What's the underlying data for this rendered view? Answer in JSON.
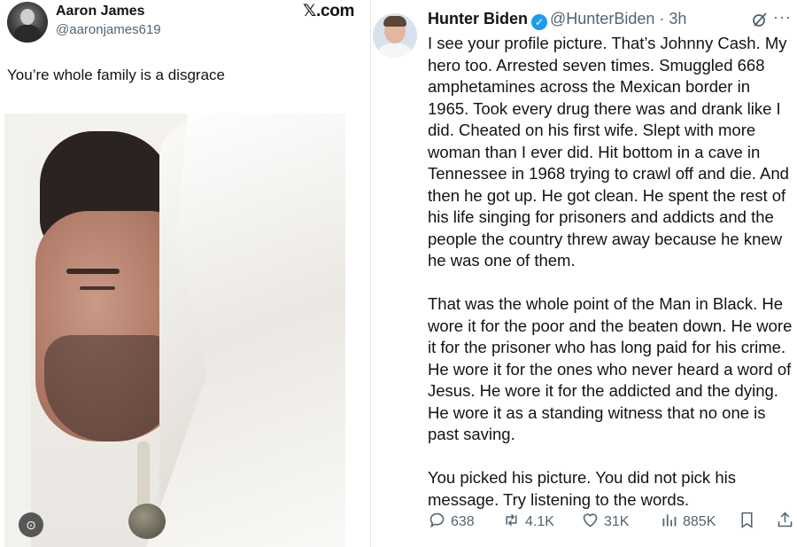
{
  "left_post": {
    "author_name": "Aaron James",
    "author_handle": "@aaronjames619",
    "text": "You’re whole family is a disgrace"
  },
  "watermark": "𝕏.com",
  "right_post": {
    "author_name": "Hunter Biden",
    "author_handle": "@HunterBiden",
    "separator": " · ",
    "time": "3h",
    "paragraphs": [
      "I see your profile picture. That’s Johnny Cash. My hero too. Arrested seven times. Smuggled 668 amphetamines across the Mexican border in 1965. Took every drug there was and drank like I did. Cheated on his first wife. Slept with more woman than I ever did. Hit bottom in a cave in Tennessee in 1968 trying to crawl off and die. And then he got up. He got clean. He spent the rest of his life singing for prisoners and addicts and the people the country threw away because he knew he was one of them.",
      "That was the whole point of the Man in Black. He wore it for the poor and the beaten down. He wore it for the prisoner who has long paid for his crime. He wore it for the ones who never heard a word of Jesus. He wore it for the addicted and the dying. He wore it as a standing witness that no one is past saving.",
      "You picked his picture. You did not pick his message. Try listening to the words."
    ],
    "stats": {
      "replies": "638",
      "reposts": "4.1K",
      "likes": "31K",
      "views": "885K"
    }
  },
  "icons": {
    "verified": "verified-badge-icon",
    "grok": "grok-icon",
    "more": "more-icon",
    "reply": "reply-icon",
    "repost": "repost-icon",
    "like": "like-icon",
    "views": "views-icon",
    "bookmark": "bookmark-icon",
    "share": "share-icon",
    "lens": "image-lens-icon"
  },
  "colors": {
    "verified": "#1d9bf0",
    "muted_text": "#536471",
    "text": "#0f1419"
  }
}
